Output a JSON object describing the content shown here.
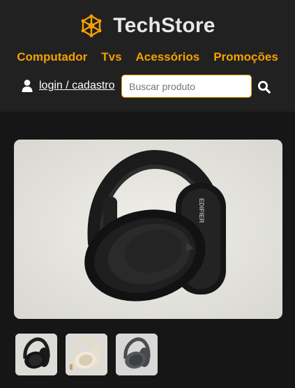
{
  "brand": {
    "name": "TechStore",
    "logo_icon": "network-hex-icon",
    "accent": "#f5a100"
  },
  "nav": {
    "items": [
      {
        "label": "Computador"
      },
      {
        "label": "Tvs"
      },
      {
        "label": "Acessórios"
      },
      {
        "label": "Promoções"
      }
    ]
  },
  "account": {
    "label": "login / cadastro",
    "icon": "user-icon"
  },
  "search": {
    "placeholder": "Buscar produto",
    "value": "",
    "icon": "search-icon"
  },
  "product": {
    "main_image": {
      "logo_text": "EDIFIER",
      "color": "black"
    },
    "thumbnails": [
      {
        "color": "black"
      },
      {
        "color": "ivory"
      },
      {
        "color": "grey"
      }
    ]
  }
}
